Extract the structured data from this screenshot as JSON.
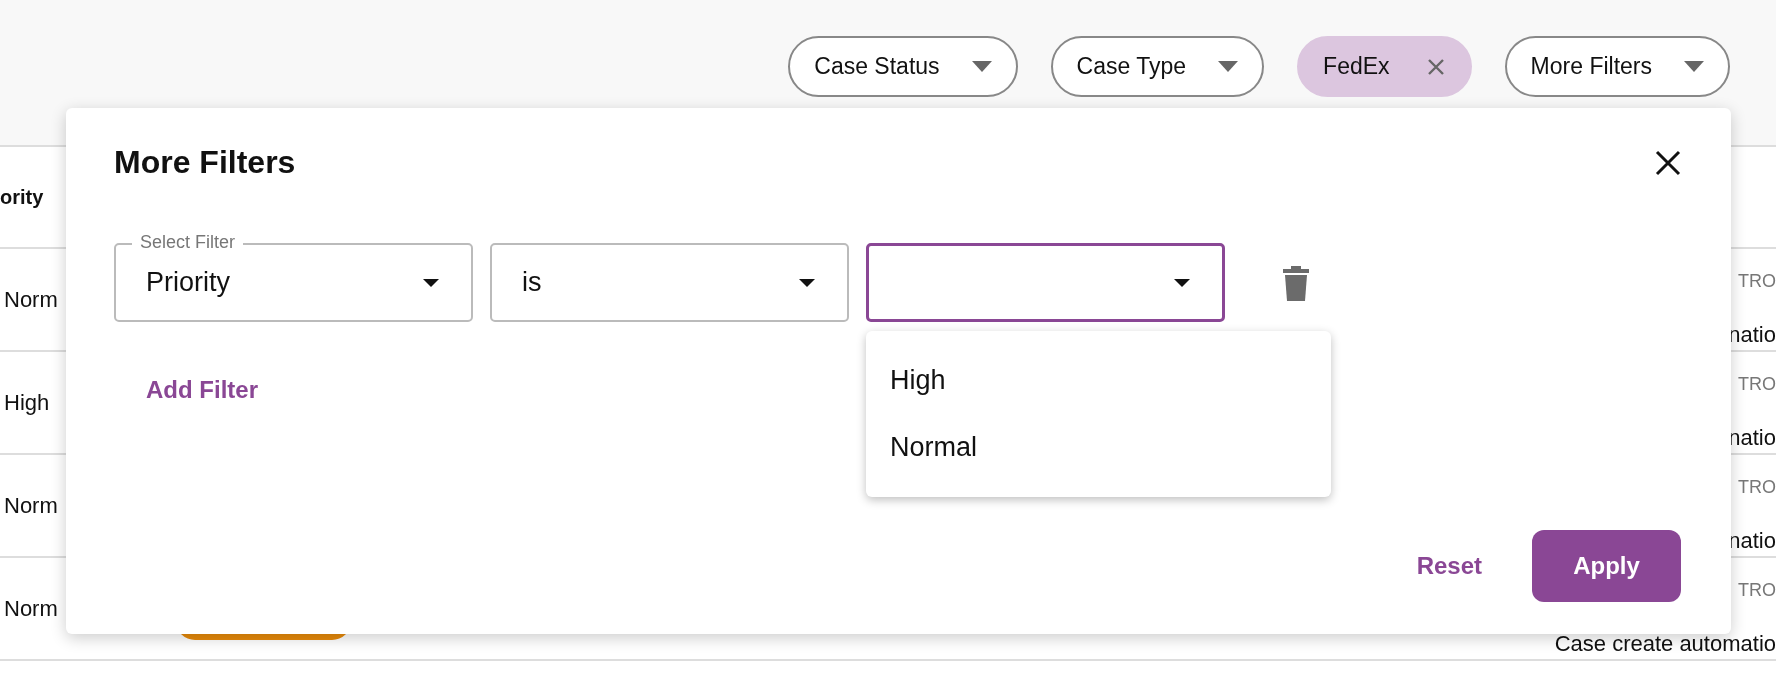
{
  "filter_bar": {
    "pills": [
      {
        "label": "Case Status",
        "kind": "dropdown"
      },
      {
        "label": "Case Type",
        "kind": "dropdown"
      },
      {
        "label": "FedEx",
        "kind": "chip"
      },
      {
        "label": "More Filters",
        "kind": "dropdown"
      }
    ]
  },
  "table": {
    "columns": [
      "ority"
    ],
    "rows": [
      {
        "priority": "Norm",
        "tag": "TRO",
        "description": "natio"
      },
      {
        "priority": "High",
        "tag": "TRO",
        "description": "natio"
      },
      {
        "priority": "Norm",
        "tag": "TRO",
        "description": "natio"
      },
      {
        "priority": "Norm",
        "tag": "TRO",
        "description": "Case create automatio",
        "status_badge": true
      }
    ]
  },
  "modal": {
    "title": "More Filters",
    "filters": [
      {
        "field": {
          "label": "Select Filter",
          "value": "Priority"
        },
        "operator": {
          "value": "is"
        },
        "value": {
          "focused": true,
          "expanded": true,
          "options": [
            {
              "label": "High"
            },
            {
              "label": "Normal"
            }
          ]
        }
      }
    ],
    "add_filter": "Add Filter",
    "buttons": {
      "reset": "Reset",
      "apply": "Apply"
    }
  }
}
